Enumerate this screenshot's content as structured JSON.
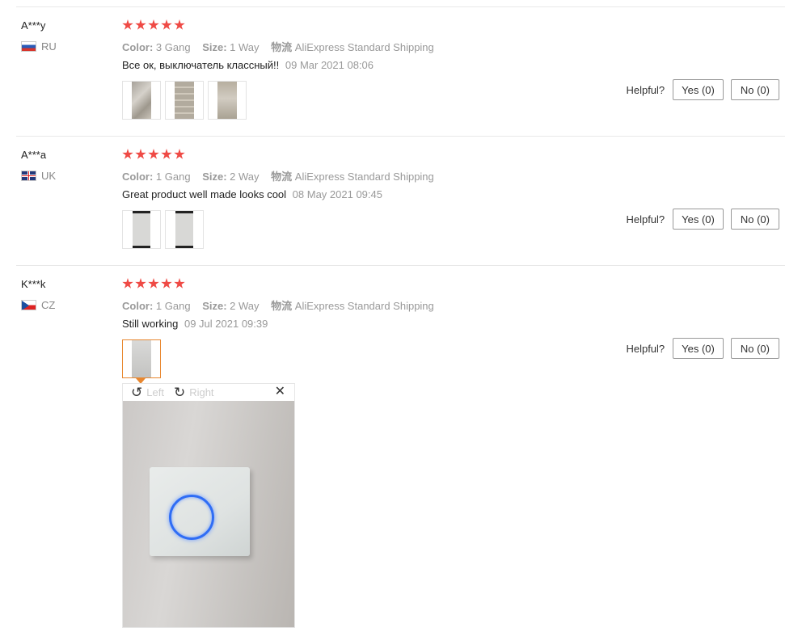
{
  "reviews": [
    {
      "user": "A***y",
      "country": "RU",
      "stars": 5,
      "color_label": "Color:",
      "color_value": "3 Gang",
      "size_label": "Size:",
      "size_value": "1 Way",
      "logistics_label": "物流",
      "logistics_value": "AliExpress Standard Shipping",
      "text": "Все ок, выключатель классный!!",
      "date": "09 Mar 2021 08:06",
      "helpful_label": "Helpful?",
      "yes_label": "Yes (0)",
      "no_label": "No (0)"
    },
    {
      "user": "A***a",
      "country": "UK",
      "stars": 5,
      "color_label": "Color:",
      "color_value": "1 Gang",
      "size_label": "Size:",
      "size_value": "2 Way",
      "logistics_label": "物流",
      "logistics_value": "AliExpress Standard Shipping",
      "text": "Great product well made looks cool",
      "date": "08 May 2021 09:45",
      "helpful_label": "Helpful?",
      "yes_label": "Yes (0)",
      "no_label": "No (0)"
    },
    {
      "user": "K***k",
      "country": "CZ",
      "stars": 5,
      "color_label": "Color:",
      "color_value": "1 Gang",
      "size_label": "Size:",
      "size_value": "2 Way",
      "logistics_label": "物流",
      "logistics_value": "AliExpress Standard Shipping",
      "text": "Still working",
      "date": "09 Jul 2021 09:39",
      "helpful_label": "Helpful?",
      "yes_label": "Yes (0)",
      "no_label": "No (0)"
    }
  ],
  "viewer": {
    "rotate_left_label": "Left",
    "rotate_right_label": "Right",
    "rotate_left_icon": "rotate-ccw-icon",
    "rotate_right_icon": "rotate-cw-icon",
    "close_icon": "close-icon"
  },
  "colors": {
    "star": "#ef4a45",
    "active_thumb_border": "#e8872f",
    "muted_text": "#999999"
  }
}
